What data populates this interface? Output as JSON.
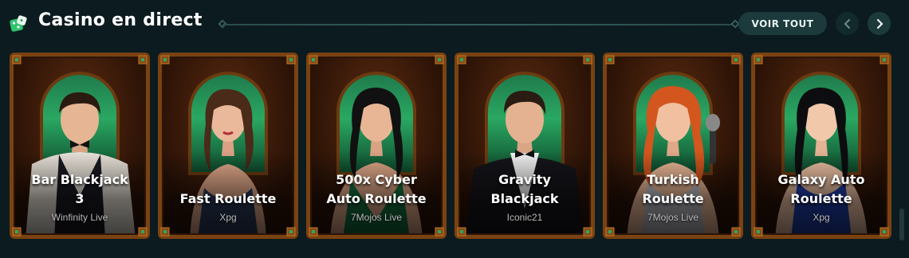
{
  "section": {
    "title": "Casino en direct",
    "view_all_label": "VOIR TOUT",
    "prev_icon": "chevron-left-icon",
    "next_icon": "chevron-right-icon",
    "section_icon": "dice-icon"
  },
  "colors": {
    "background": "#0c1b1f",
    "button": "#1c3a3c",
    "frame": "#7a4212",
    "arch_green": "#2aa862"
  },
  "games": [
    {
      "name": "Bar Blackjack\n3",
      "provider": "Winfinity Live"
    },
    {
      "name": "Fast Roulette",
      "provider": "Xpg"
    },
    {
      "name": "500x Cyber\nAuto Roulette",
      "provider": "7Mojos Live"
    },
    {
      "name": "Gravity\nBlackjack",
      "provider": "Iconic21"
    },
    {
      "name": "Turkish\nRoulette",
      "provider": "7Mojos Live"
    },
    {
      "name": "Galaxy Auto\nRoulette",
      "provider": "Xpg"
    }
  ]
}
